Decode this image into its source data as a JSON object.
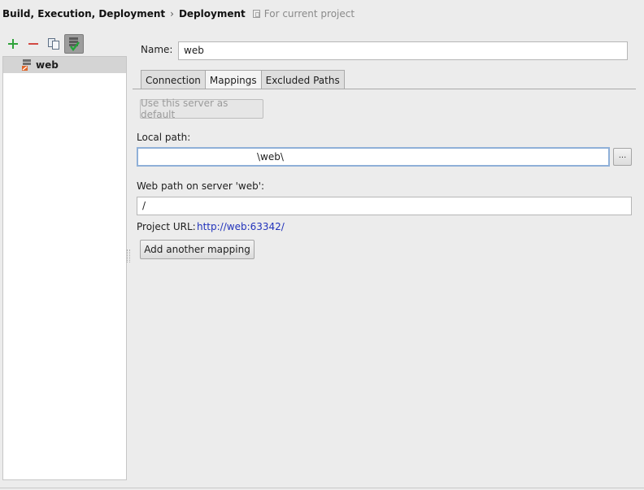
{
  "breadcrumb": {
    "items": [
      "Build, Execution, Deployment",
      "Deployment"
    ],
    "separator": "›",
    "scope_label": "For current project"
  },
  "toolbar": {
    "add": "add-icon",
    "remove": "remove-icon",
    "copy": "copy-icon",
    "use_as_default": "default-server-icon"
  },
  "servers": [
    {
      "label": "web",
      "selected": true
    }
  ],
  "form": {
    "name_label": "Name:",
    "name_value": "web",
    "tabs": [
      {
        "label": "Connection",
        "active": false
      },
      {
        "label": "Mappings",
        "active": true
      },
      {
        "label": "Excluded Paths",
        "active": false
      }
    ],
    "use_default_button": "Use this server as default",
    "local_path_label": "Local path:",
    "local_path_value": "\\web\\",
    "browse_button": "...",
    "web_path_label": "Web path on server 'web':",
    "web_path_value": "/",
    "project_url_label": "Project URL:",
    "project_url_value": "http://web:63342/",
    "add_mapping_button": "Add another mapping"
  },
  "colors": {
    "background": "#ececec",
    "link": "#2233bb",
    "add_green": "#2fa33a",
    "remove_red": "#d24a43",
    "focus_border": "#8fb0d8"
  }
}
